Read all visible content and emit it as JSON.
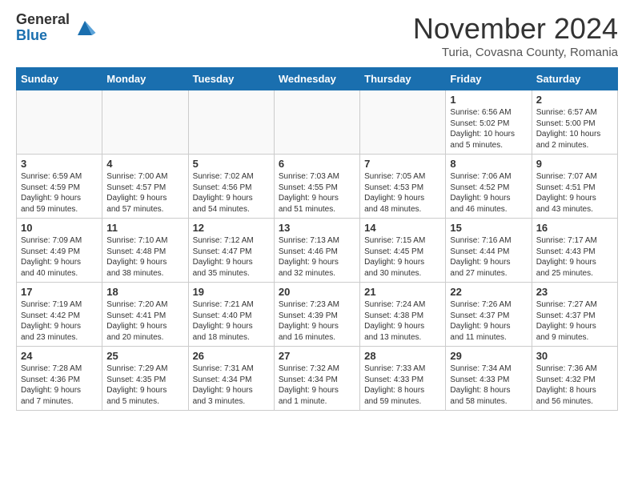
{
  "logo": {
    "general": "General",
    "blue": "Blue"
  },
  "title": "November 2024",
  "location": "Turia, Covasna County, Romania",
  "days_of_week": [
    "Sunday",
    "Monday",
    "Tuesday",
    "Wednesday",
    "Thursday",
    "Friday",
    "Saturday"
  ],
  "weeks": [
    [
      {
        "day": "",
        "info": ""
      },
      {
        "day": "",
        "info": ""
      },
      {
        "day": "",
        "info": ""
      },
      {
        "day": "",
        "info": ""
      },
      {
        "day": "",
        "info": ""
      },
      {
        "day": "1",
        "info": "Sunrise: 6:56 AM\nSunset: 5:02 PM\nDaylight: 10 hours\nand 5 minutes."
      },
      {
        "day": "2",
        "info": "Sunrise: 6:57 AM\nSunset: 5:00 PM\nDaylight: 10 hours\nand 2 minutes."
      }
    ],
    [
      {
        "day": "3",
        "info": "Sunrise: 6:59 AM\nSunset: 4:59 PM\nDaylight: 9 hours\nand 59 minutes."
      },
      {
        "day": "4",
        "info": "Sunrise: 7:00 AM\nSunset: 4:57 PM\nDaylight: 9 hours\nand 57 minutes."
      },
      {
        "day": "5",
        "info": "Sunrise: 7:02 AM\nSunset: 4:56 PM\nDaylight: 9 hours\nand 54 minutes."
      },
      {
        "day": "6",
        "info": "Sunrise: 7:03 AM\nSunset: 4:55 PM\nDaylight: 9 hours\nand 51 minutes."
      },
      {
        "day": "7",
        "info": "Sunrise: 7:05 AM\nSunset: 4:53 PM\nDaylight: 9 hours\nand 48 minutes."
      },
      {
        "day": "8",
        "info": "Sunrise: 7:06 AM\nSunset: 4:52 PM\nDaylight: 9 hours\nand 46 minutes."
      },
      {
        "day": "9",
        "info": "Sunrise: 7:07 AM\nSunset: 4:51 PM\nDaylight: 9 hours\nand 43 minutes."
      }
    ],
    [
      {
        "day": "10",
        "info": "Sunrise: 7:09 AM\nSunset: 4:49 PM\nDaylight: 9 hours\nand 40 minutes."
      },
      {
        "day": "11",
        "info": "Sunrise: 7:10 AM\nSunset: 4:48 PM\nDaylight: 9 hours\nand 38 minutes."
      },
      {
        "day": "12",
        "info": "Sunrise: 7:12 AM\nSunset: 4:47 PM\nDaylight: 9 hours\nand 35 minutes."
      },
      {
        "day": "13",
        "info": "Sunrise: 7:13 AM\nSunset: 4:46 PM\nDaylight: 9 hours\nand 32 minutes."
      },
      {
        "day": "14",
        "info": "Sunrise: 7:15 AM\nSunset: 4:45 PM\nDaylight: 9 hours\nand 30 minutes."
      },
      {
        "day": "15",
        "info": "Sunrise: 7:16 AM\nSunset: 4:44 PM\nDaylight: 9 hours\nand 27 minutes."
      },
      {
        "day": "16",
        "info": "Sunrise: 7:17 AM\nSunset: 4:43 PM\nDaylight: 9 hours\nand 25 minutes."
      }
    ],
    [
      {
        "day": "17",
        "info": "Sunrise: 7:19 AM\nSunset: 4:42 PM\nDaylight: 9 hours\nand 23 minutes."
      },
      {
        "day": "18",
        "info": "Sunrise: 7:20 AM\nSunset: 4:41 PM\nDaylight: 9 hours\nand 20 minutes."
      },
      {
        "day": "19",
        "info": "Sunrise: 7:21 AM\nSunset: 4:40 PM\nDaylight: 9 hours\nand 18 minutes."
      },
      {
        "day": "20",
        "info": "Sunrise: 7:23 AM\nSunset: 4:39 PM\nDaylight: 9 hours\nand 16 minutes."
      },
      {
        "day": "21",
        "info": "Sunrise: 7:24 AM\nSunset: 4:38 PM\nDaylight: 9 hours\nand 13 minutes."
      },
      {
        "day": "22",
        "info": "Sunrise: 7:26 AM\nSunset: 4:37 PM\nDaylight: 9 hours\nand 11 minutes."
      },
      {
        "day": "23",
        "info": "Sunrise: 7:27 AM\nSunset: 4:37 PM\nDaylight: 9 hours\nand 9 minutes."
      }
    ],
    [
      {
        "day": "24",
        "info": "Sunrise: 7:28 AM\nSunset: 4:36 PM\nDaylight: 9 hours\nand 7 minutes."
      },
      {
        "day": "25",
        "info": "Sunrise: 7:29 AM\nSunset: 4:35 PM\nDaylight: 9 hours\nand 5 minutes."
      },
      {
        "day": "26",
        "info": "Sunrise: 7:31 AM\nSunset: 4:34 PM\nDaylight: 9 hours\nand 3 minutes."
      },
      {
        "day": "27",
        "info": "Sunrise: 7:32 AM\nSunset: 4:34 PM\nDaylight: 9 hours\nand 1 minute."
      },
      {
        "day": "28",
        "info": "Sunrise: 7:33 AM\nSunset: 4:33 PM\nDaylight: 8 hours\nand 59 minutes."
      },
      {
        "day": "29",
        "info": "Sunrise: 7:34 AM\nSunset: 4:33 PM\nDaylight: 8 hours\nand 58 minutes."
      },
      {
        "day": "30",
        "info": "Sunrise: 7:36 AM\nSunset: 4:32 PM\nDaylight: 8 hours\nand 56 minutes."
      }
    ]
  ]
}
